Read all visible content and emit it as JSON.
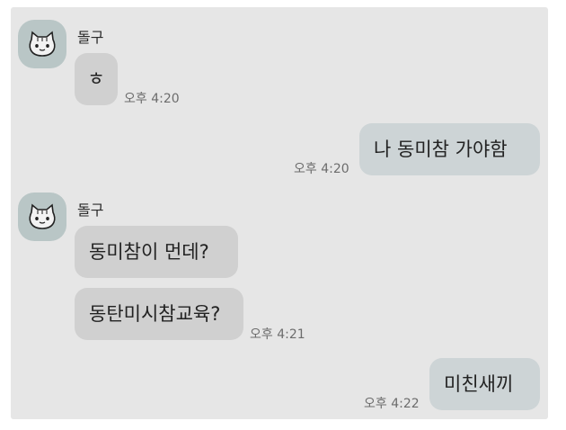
{
  "chat": {
    "groups": [
      {
        "sender": "돌구",
        "avatar_icon": "cat-face-icon",
        "messages": [
          "ㅎ"
        ],
        "time": "오후 4:20"
      },
      {
        "sender": "me",
        "messages": [
          "나 동미참 가야함"
        ],
        "time": "오후 4:20"
      },
      {
        "sender": "돌구",
        "avatar_icon": "cat-face-icon",
        "messages": [
          "동미참이 먼데?",
          "동탄미시참교육?"
        ],
        "time": "오후 4:21"
      },
      {
        "sender": "me",
        "messages": [
          "미친새끼"
        ],
        "time": "오후 4:22"
      }
    ]
  },
  "colors": {
    "background": "#e6e6e6",
    "incoming_bubble": "#d0d0d0",
    "outgoing_bubble": "#cdd4d6",
    "avatar_bg": "#b9c6c6"
  }
}
